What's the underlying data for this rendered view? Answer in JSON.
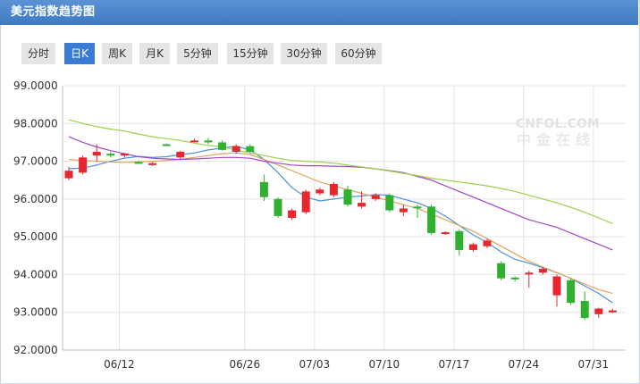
{
  "title": "美元指数趋势图",
  "tabs": [
    {
      "label": "分时",
      "active": false
    },
    {
      "label": "日K",
      "active": true
    },
    {
      "label": "周K",
      "active": false
    },
    {
      "label": "月K",
      "active": false
    },
    {
      "label": "5分钟",
      "active": false
    },
    {
      "label": "15分钟",
      "active": false
    },
    {
      "label": "30分钟",
      "active": false
    },
    {
      "label": "60分钟",
      "active": false
    }
  ],
  "watermark": {
    "line1": "CNFOL.COM",
    "line2": "中金在线"
  },
  "colors": {
    "up": "#e8262d",
    "down": "#2fb12f",
    "ma5": "#4a90d9",
    "ma10": "#e0a35a",
    "ma20": "#a346c8",
    "ma30": "#9ccf4b"
  },
  "chart_data": {
    "type": "candlestick",
    "ylim": [
      92.0,
      99.0
    ],
    "yticks": [
      "99.0000",
      "98.0000",
      "97.0000",
      "96.0000",
      "95.0000",
      "94.0000",
      "93.0000",
      "92.0000"
    ],
    "xticks": [
      "06/12",
      "06/26",
      "07/03",
      "07/10",
      "07/17",
      "07/24",
      "07/31"
    ],
    "grid": true,
    "candles": [
      {
        "o": 96.55,
        "c": 96.75,
        "h": 96.85,
        "l": 96.5
      },
      {
        "o": 96.7,
        "c": 97.1,
        "h": 97.15,
        "l": 96.65
      },
      {
        "o": 97.15,
        "c": 97.25,
        "h": 97.45,
        "l": 97.0
      },
      {
        "o": 97.2,
        "c": 97.15,
        "h": 97.25,
        "l": 97.1
      },
      {
        "o": 97.15,
        "c": 97.2,
        "h": 97.22,
        "l": 97.1
      },
      {
        "o": 96.98,
        "c": 96.97,
        "h": 97.02,
        "l": 96.93
      },
      {
        "o": 96.9,
        "c": 96.95,
        "h": 96.98,
        "l": 96.88
      },
      {
        "o": 97.45,
        "c": 97.44,
        "h": 97.47,
        "l": 97.42
      },
      {
        "o": 97.1,
        "c": 97.25,
        "h": 97.28,
        "l": 97.05
      },
      {
        "o": 97.52,
        "c": 97.55,
        "h": 97.6,
        "l": 97.5
      },
      {
        "o": 97.55,
        "c": 97.5,
        "h": 97.62,
        "l": 97.45
      },
      {
        "o": 97.5,
        "c": 97.3,
        "h": 97.55,
        "l": 97.28
      },
      {
        "o": 97.25,
        "c": 97.4,
        "h": 97.45,
        "l": 97.2
      },
      {
        "o": 97.4,
        "c": 97.25,
        "h": 97.45,
        "l": 97.22
      },
      {
        "o": 96.45,
        "c": 96.05,
        "h": 96.65,
        "l": 95.95
      },
      {
        "o": 96.0,
        "c": 95.55,
        "h": 96.05,
        "l": 95.5
      },
      {
        "o": 95.5,
        "c": 95.7,
        "h": 95.75,
        "l": 95.45
      },
      {
        "o": 95.65,
        "c": 96.2,
        "h": 96.25,
        "l": 95.6
      },
      {
        "o": 96.15,
        "c": 96.25,
        "h": 96.3,
        "l": 96.1
      },
      {
        "o": 96.1,
        "c": 96.4,
        "h": 96.45,
        "l": 96.05
      },
      {
        "o": 96.25,
        "c": 95.85,
        "h": 96.35,
        "l": 95.8
      },
      {
        "o": 95.8,
        "c": 95.9,
        "h": 96.2,
        "l": 95.75
      },
      {
        "o": 96.0,
        "c": 96.1,
        "h": 96.15,
        "l": 95.95
      },
      {
        "o": 96.1,
        "c": 95.7,
        "h": 96.15,
        "l": 95.65
      },
      {
        "o": 95.65,
        "c": 95.75,
        "h": 95.85,
        "l": 95.55
      },
      {
        "o": 95.8,
        "c": 95.78,
        "h": 95.85,
        "l": 95.5
      },
      {
        "o": 95.8,
        "c": 95.1,
        "h": 95.85,
        "l": 95.05
      },
      {
        "o": 95.1,
        "c": 95.12,
        "h": 95.15,
        "l": 95.05
      },
      {
        "o": 95.15,
        "c": 94.65,
        "h": 95.2,
        "l": 94.5
      },
      {
        "o": 94.65,
        "c": 94.8,
        "h": 94.85,
        "l": 94.6
      },
      {
        "o": 94.75,
        "c": 94.9,
        "h": 94.95,
        "l": 94.7
      },
      {
        "o": 94.3,
        "c": 93.9,
        "h": 94.35,
        "l": 93.85
      },
      {
        "o": 93.92,
        "c": 93.88,
        "h": 93.95,
        "l": 93.82
      },
      {
        "o": 94.02,
        "c": 94.05,
        "h": 94.1,
        "l": 93.65
      },
      {
        "o": 94.05,
        "c": 94.15,
        "h": 94.2,
        "l": 94.0
      },
      {
        "o": 93.45,
        "c": 93.95,
        "h": 94.0,
        "l": 93.15
      },
      {
        "o": 93.85,
        "c": 93.25,
        "h": 93.9,
        "l": 93.2
      },
      {
        "o": 93.3,
        "c": 92.85,
        "h": 93.55,
        "l": 92.8
      },
      {
        "o": 92.95,
        "c": 93.1,
        "h": 93.12,
        "l": 92.85
      },
      {
        "o": 93.0,
        "c": 93.05,
        "h": 93.1,
        "l": 92.98
      }
    ],
    "ma": [
      {
        "name": "MA5",
        "color": "#4a90d9",
        "values": [
          96.8,
          96.82,
          96.9,
          97.0,
          97.08,
          97.13,
          97.1,
          97.12,
          97.18,
          97.22,
          97.3,
          97.35,
          97.4,
          97.3,
          97.05,
          96.7,
          96.3,
          96.05,
          95.95,
          96.0,
          96.05,
          96.08,
          96.12,
          96.1,
          96.0,
          95.9,
          95.75,
          95.55,
          95.3,
          95.05,
          94.85,
          94.6,
          94.4,
          94.3,
          94.18,
          94.05,
          93.9,
          93.7,
          93.5,
          93.25
        ]
      },
      {
        "name": "MA10",
        "color": "#e0a35a",
        "values": [
          97.05,
          97.02,
          97.0,
          96.98,
          96.97,
          96.98,
          97.0,
          97.02,
          97.05,
          97.1,
          97.15,
          97.2,
          97.22,
          97.18,
          97.05,
          96.9,
          96.75,
          96.6,
          96.45,
          96.35,
          96.25,
          96.15,
          96.05,
          95.95,
          95.85,
          95.75,
          95.6,
          95.45,
          95.3,
          95.15,
          94.95,
          94.75,
          94.55,
          94.35,
          94.2,
          94.05,
          93.9,
          93.75,
          93.6,
          93.5
        ]
      },
      {
        "name": "MA20",
        "color": "#a346c8",
        "values": [
          97.65,
          97.5,
          97.38,
          97.28,
          97.2,
          97.12,
          97.08,
          97.06,
          97.05,
          97.06,
          97.08,
          97.1,
          97.1,
          97.08,
          97.0,
          96.95,
          96.9,
          96.88,
          96.88,
          96.87,
          96.86,
          96.84,
          96.8,
          96.75,
          96.7,
          96.6,
          96.5,
          96.35,
          96.2,
          96.05,
          95.9,
          95.75,
          95.6,
          95.45,
          95.35,
          95.25,
          95.1,
          94.95,
          94.8,
          94.65
        ]
      },
      {
        "name": "MA30",
        "color": "#9ccf4b",
        "values": [
          98.1,
          98.0,
          97.92,
          97.85,
          97.8,
          97.72,
          97.65,
          97.6,
          97.55,
          97.48,
          97.42,
          97.38,
          97.3,
          97.22,
          97.15,
          97.08,
          97.02,
          97.0,
          96.98,
          96.95,
          96.9,
          96.85,
          96.8,
          96.74,
          96.68,
          96.62,
          96.55,
          96.5,
          96.45,
          96.4,
          96.35,
          96.28,
          96.2,
          96.1,
          96.0,
          95.9,
          95.78,
          95.65,
          95.5,
          95.35
        ]
      }
    ]
  }
}
